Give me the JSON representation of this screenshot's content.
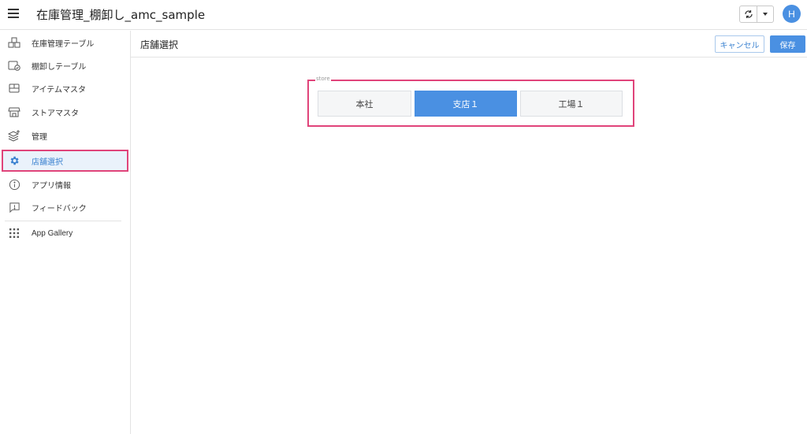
{
  "app": {
    "title": "在庫管理_棚卸し_amc_sample",
    "avatar_letter": "H"
  },
  "sidebar": {
    "items": [
      {
        "label": "在庫管理テーブル",
        "icon": "boxes-icon"
      },
      {
        "label": "棚卸しテーブル",
        "icon": "box-check-icon"
      },
      {
        "label": "アイテムマスタ",
        "icon": "package-icon"
      },
      {
        "label": "ストアマスタ",
        "icon": "store-icon"
      },
      {
        "label": "管理",
        "icon": "layers-add-icon"
      },
      {
        "label": "店舗選択",
        "icon": "gear-icon",
        "active": true
      },
      {
        "label": "アプリ情報",
        "icon": "info-icon"
      },
      {
        "label": "フィードバック",
        "icon": "feedback-icon"
      },
      {
        "label": "App Gallery",
        "icon": "grid-icon"
      }
    ]
  },
  "header": {
    "page_title": "店舗選択",
    "cancel_label": "キャンセル",
    "save_label": "保存"
  },
  "store_field": {
    "label": "store",
    "options": [
      "本社",
      "支店１",
      "工場１"
    ],
    "selected": "支店１"
  },
  "colors": {
    "accent": "#4a90e2",
    "highlight": "#e0447a"
  }
}
